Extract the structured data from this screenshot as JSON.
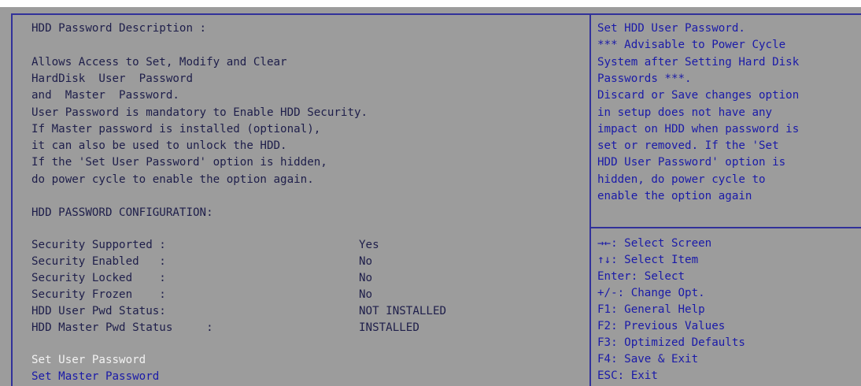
{
  "description": {
    "heading": "HDD Password Description :",
    "lines": [
      "Allows Access to Set, Modify and Clear",
      "HardDisk  User  Password",
      "and  Master  Password.",
      "User Password is mandatory to Enable HDD Security.",
      "If Master password is installed (optional),",
      "it can also be used to unlock the HDD.",
      "If the 'Set User Password' option is hidden,",
      "do power cycle to enable the option again."
    ]
  },
  "config": {
    "heading": "HDD PASSWORD CONFIGURATION:",
    "rows": [
      {
        "label": "Security Supported :",
        "value": "Yes"
      },
      {
        "label": "Security Enabled   :",
        "value": "No"
      },
      {
        "label": "Security Locked    :",
        "value": "No"
      },
      {
        "label": "Security Frozen    :",
        "value": "No"
      },
      {
        "label": "HDD User Pwd Status:",
        "value": "NOT INSTALLED"
      },
      {
        "label": "HDD Master Pwd Status     :",
        "value": "INSTALLED"
      }
    ]
  },
  "menu": {
    "set_user_password": "Set User Password",
    "set_master_password": "Set Master Password"
  },
  "help": {
    "lines": [
      "Set HDD User Password.",
      "*** Advisable to Power Cycle",
      "System after Setting Hard Disk",
      "Passwords ***.",
      "Discard or Save changes option",
      "in setup does not have any",
      "impact on HDD when password is",
      "set or removed. If the 'Set",
      "HDD User Password' option is",
      "hidden, do power cycle to",
      "enable the option again"
    ]
  },
  "keys": [
    {
      "key": "→←",
      "desc": ": Select Screen"
    },
    {
      "key": "↑↓",
      "desc": ": Select Item"
    },
    {
      "key": "Enter",
      "desc": ": Select"
    },
    {
      "key": "+/-",
      "desc": ": Change Opt."
    },
    {
      "key": "F1",
      "desc": ": General Help"
    },
    {
      "key": "F2",
      "desc": ": Previous Values"
    },
    {
      "key": "F3",
      "desc": ": Optimized Defaults"
    },
    {
      "key": "F4",
      "desc": ": Save & Exit"
    },
    {
      "key": "ESC",
      "desc": ": Exit"
    }
  ],
  "colors": {
    "background": "#9c9c9c",
    "frame": "#31319a",
    "text_dark": "#1e1e4a",
    "text_blue": "#1a1aa8",
    "selected": "#f2f2f2"
  }
}
